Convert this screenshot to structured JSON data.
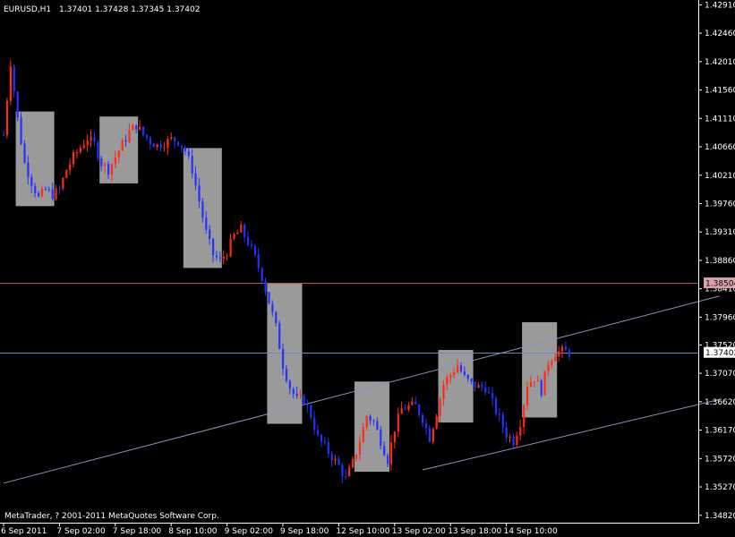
{
  "header": {
    "symbol": "EURUSD,H1",
    "ohlc": "1.37401 1.37428 1.37345 1.37402"
  },
  "footer": {
    "copyright": "MetaTrader, ? 2001-2011 MetaQuotes Software Corp."
  },
  "colors": {
    "background": "#000000",
    "bull": "#ff2a1a",
    "bear": "#2233ff",
    "box": "#9a9a9a",
    "channel": "#8b94b8",
    "price_line_red": "#c85050",
    "price_line_blue": "#6e86c0",
    "axis": "#ffffff"
  },
  "chart_data": {
    "type": "candlestick",
    "symbol": "EURUSD",
    "timeframe": "H1",
    "ylim": [
      1.3476,
      1.4293
    ],
    "y_ticks": [
      "1.42910",
      "1.42460",
      "1.42010",
      "1.41560",
      "1.41110",
      "1.40660",
      "1.40210",
      "1.39760",
      "1.39310",
      "1.38860",
      "1.38410",
      "1.37960",
      "1.37520",
      "1.37070",
      "1.36620",
      "1.36170",
      "1.35720",
      "1.35270",
      "1.34820"
    ],
    "x_ticks": [
      "6 Sep 2011",
      "7 Sep 02:00",
      "7 Sep 18:00",
      "8 Sep 10:00",
      "9 Sep 02:00",
      "9 Sep 18:00",
      "12 Sep 10:00",
      "13 Sep 02:00",
      "13 Sep 18:00",
      "14 Sep 10:00"
    ],
    "price_labels": [
      {
        "label": "1.38504",
        "price": 1.38504,
        "kind": "red"
      },
      {
        "label": "1.37402",
        "price": 1.37402,
        "kind": "blue"
      }
    ],
    "highlight_boxes": [
      {
        "from_idx": 4,
        "to_idx": 14,
        "top": 1.4122,
        "bottom": 1.3972
      },
      {
        "from_idx": 28,
        "to_idx": 38,
        "top": 1.4114,
        "bottom": 1.4008
      },
      {
        "from_idx": 52,
        "to_idx": 62,
        "top": 1.4064,
        "bottom": 1.3874
      },
      {
        "from_idx": 76,
        "to_idx": 85,
        "top": 1.3849,
        "bottom": 1.3627
      },
      {
        "from_idx": 101,
        "to_idx": 110,
        "top": 1.3694,
        "bottom": 1.3551
      },
      {
        "from_idx": 125,
        "to_idx": 134,
        "top": 1.3744,
        "bottom": 1.3629
      },
      {
        "from_idx": 149,
        "to_idx": 158,
        "top": 1.3788,
        "bottom": 1.3637
      }
    ],
    "trendlines": [
      {
        "from_idx": 0,
        "from_price": 1.3533,
        "to_idx": 205,
        "to_price": 1.38295
      },
      {
        "from_idx": 120,
        "from_price": 1.3554,
        "to_idx": 205,
        "to_price": 1.36655
      }
    ],
    "close_points": [
      [
        0,
        1.4085
      ],
      [
        2,
        1.42
      ],
      [
        4,
        1.411
      ],
      [
        6,
        1.404
      ],
      [
        8,
        1.401
      ],
      [
        10,
        1.3985
      ],
      [
        12,
        1.3998
      ],
      [
        14,
        1.399
      ],
      [
        16,
        1.3998
      ],
      [
        18,
        1.403
      ],
      [
        20,
        1.405
      ],
      [
        22,
        1.4065
      ],
      [
        24,
        1.408
      ],
      [
        26,
        1.407
      ],
      [
        28,
        1.404
      ],
      [
        30,
        1.403
      ],
      [
        32,
        1.405
      ],
      [
        34,
        1.407
      ],
      [
        36,
        1.409
      ],
      [
        38,
        1.41
      ],
      [
        40,
        1.4085
      ],
      [
        42,
        1.4075
      ],
      [
        44,
        1.4068
      ],
      [
        46,
        1.4072
      ],
      [
        48,
        1.4078
      ],
      [
        50,
        1.4075
      ],
      [
        52,
        1.406
      ],
      [
        54,
        1.403
      ],
      [
        56,
        1.398
      ],
      [
        58,
        1.393
      ],
      [
        60,
        1.3895
      ],
      [
        62,
        1.3885
      ],
      [
        64,
        1.39
      ],
      [
        66,
        1.3925
      ],
      [
        68,
        1.3935
      ],
      [
        70,
        1.3915
      ],
      [
        72,
        1.389
      ],
      [
        74,
        1.386
      ],
      [
        76,
        1.382
      ],
      [
        78,
        1.378
      ],
      [
        80,
        1.372
      ],
      [
        82,
        1.3685
      ],
      [
        84,
        1.3665
      ],
      [
        86,
        1.3665
      ],
      [
        88,
        1.364
      ],
      [
        90,
        1.3605
      ],
      [
        92,
        1.359
      ],
      [
        94,
        1.3575
      ],
      [
        96,
        1.356
      ],
      [
        98,
        1.354
      ],
      [
        100,
        1.3565
      ],
      [
        102,
        1.36
      ],
      [
        104,
        1.364
      ],
      [
        106,
        1.363
      ],
      [
        108,
        1.36
      ],
      [
        110,
        1.357
      ],
      [
        112,
        1.362
      ],
      [
        114,
        1.365
      ],
      [
        116,
        1.3655
      ],
      [
        118,
        1.3655
      ],
      [
        120,
        1.3635
      ],
      [
        122,
        1.3605
      ],
      [
        124,
        1.3645
      ],
      [
        126,
        1.369
      ],
      [
        128,
        1.3705
      ],
      [
        130,
        1.372
      ],
      [
        132,
        1.37
      ],
      [
        134,
        1.369
      ],
      [
        136,
        1.3685
      ],
      [
        138,
        1.3685
      ],
      [
        140,
        1.366
      ],
      [
        142,
        1.3635
      ],
      [
        144,
        1.361
      ],
      [
        146,
        1.36
      ],
      [
        148,
        1.363
      ],
      [
        150,
        1.369
      ],
      [
        152,
        1.37
      ],
      [
        154,
        1.368
      ],
      [
        156,
        1.3725
      ],
      [
        158,
        1.374
      ],
      [
        160,
        1.3742
      ],
      [
        162,
        1.374
      ]
    ],
    "grid": false,
    "legend": "none"
  }
}
